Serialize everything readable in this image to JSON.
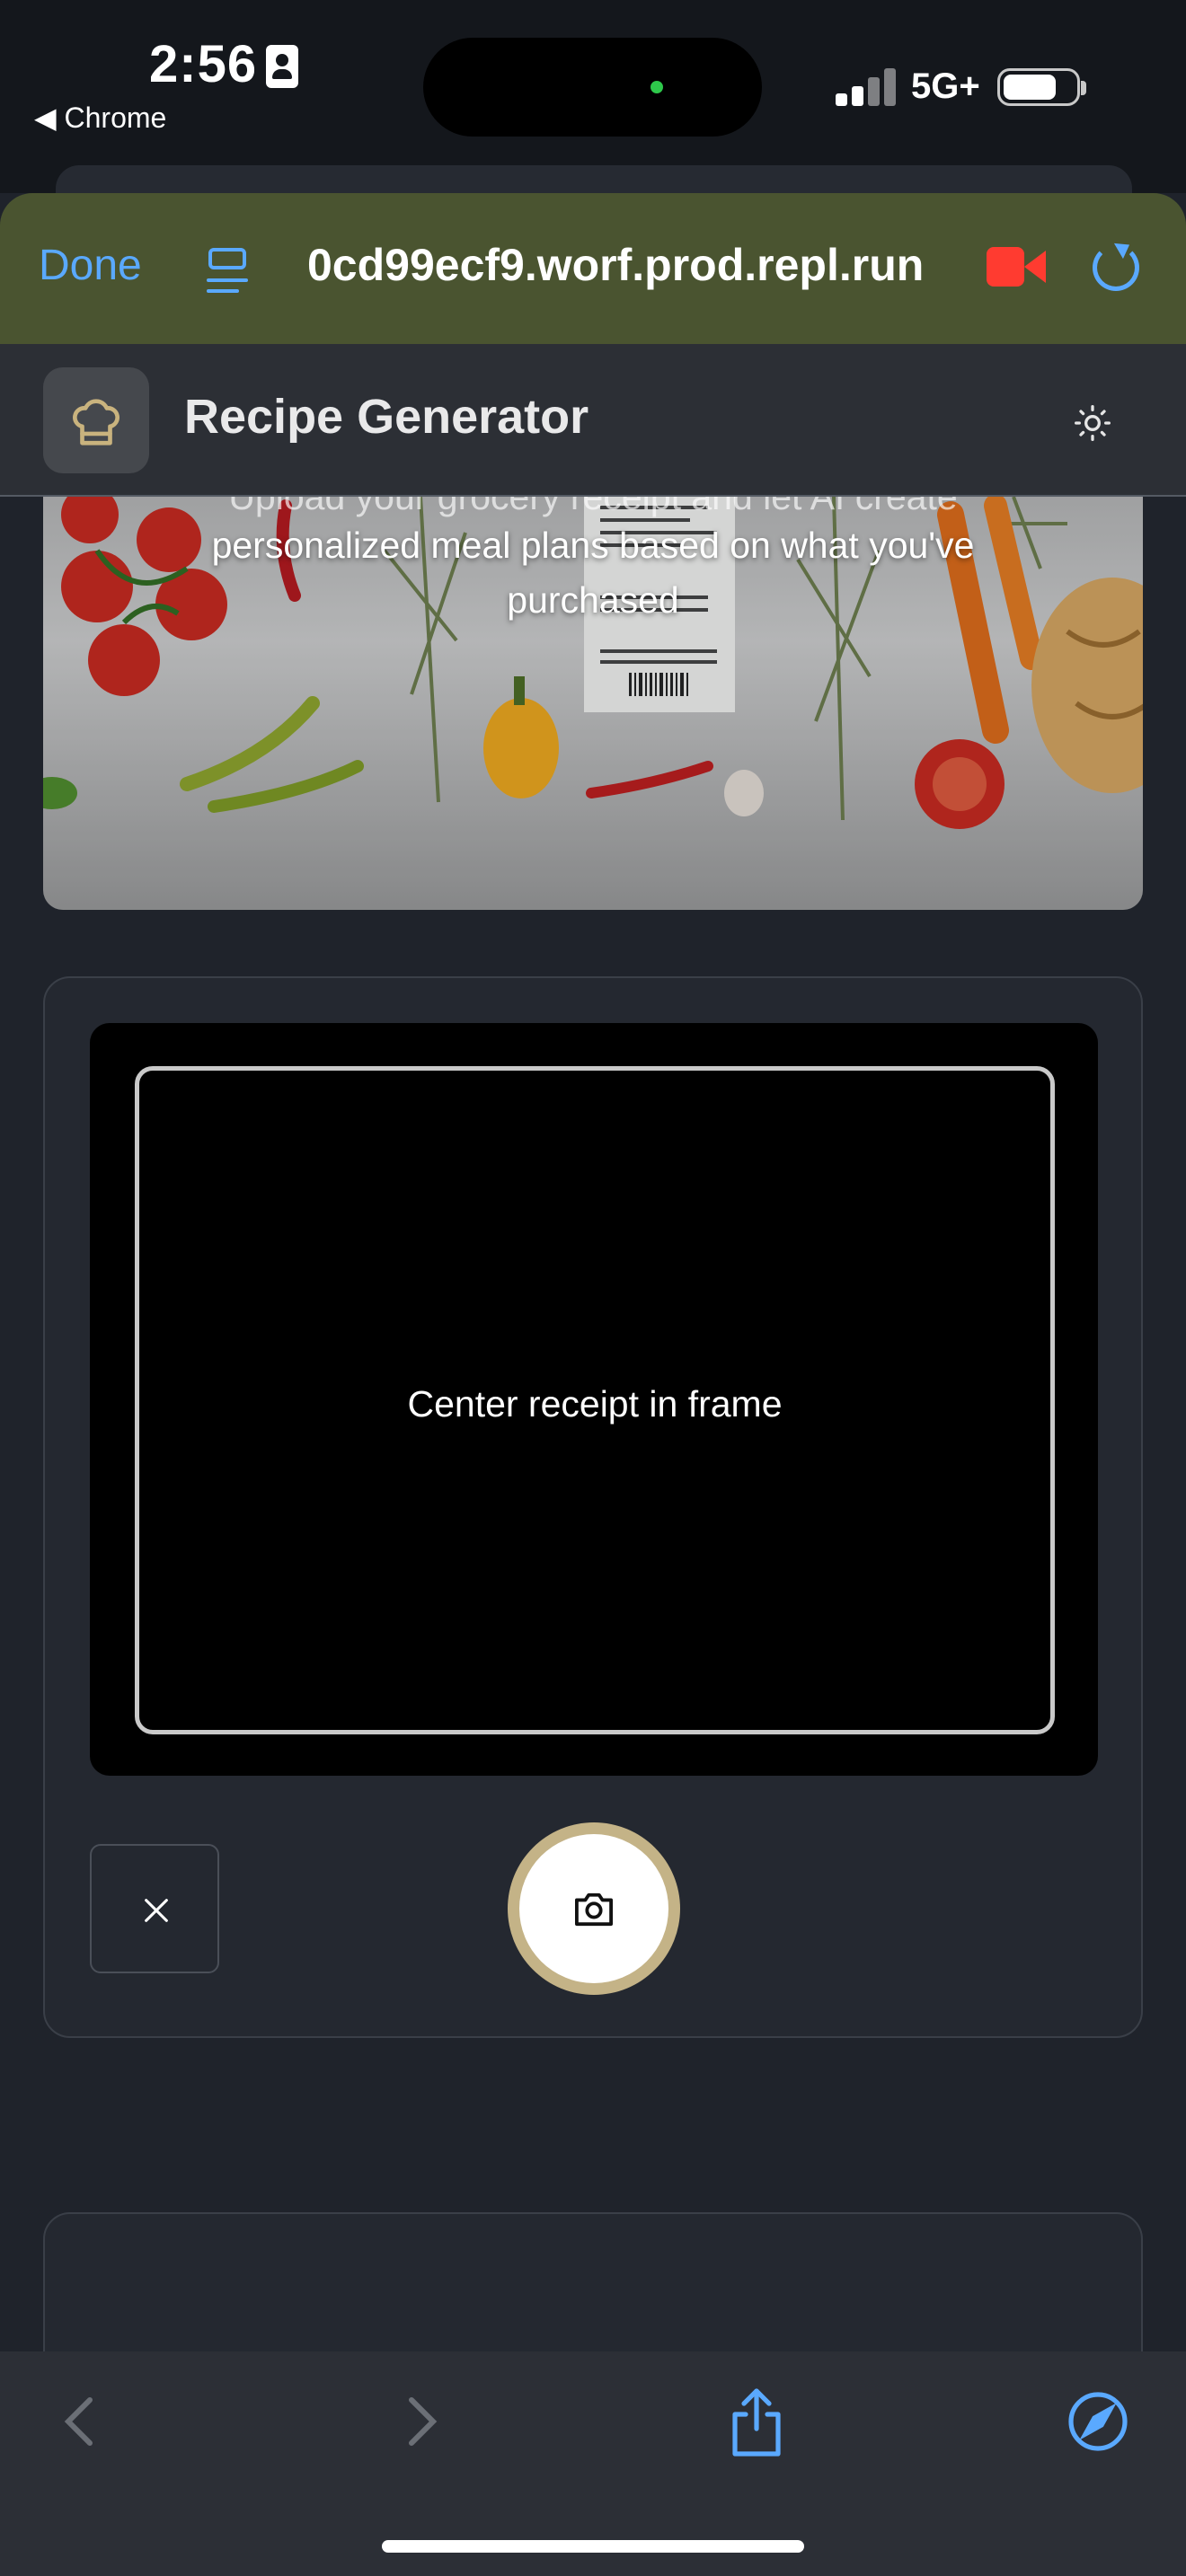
{
  "status_bar": {
    "time": "2:56",
    "back_app": "◀ Chrome",
    "network": "5G+"
  },
  "browser": {
    "done_label": "Done",
    "url": "0cd99ecf9.worf.prod.repl.run",
    "icons": [
      "tabs-icon",
      "recording-icon",
      "reload-icon",
      "back-icon",
      "forward-icon",
      "share-icon",
      "compass-icon"
    ],
    "accent_color": "#5aa9ff"
  },
  "app": {
    "title": "Recipe Generator",
    "logo_icon": "chef-hat-icon",
    "theme_icon": "sun-icon"
  },
  "hero": {
    "description_prev": "Upload your grocery receipt and let AI create",
    "description": "personalized meal plans based on what you've purchased"
  },
  "camera": {
    "frame_label": "Center receipt in frame",
    "close_icon": "close-icon",
    "capture_icon": "camera-icon",
    "shutter_ring_color": "#c4b387"
  }
}
